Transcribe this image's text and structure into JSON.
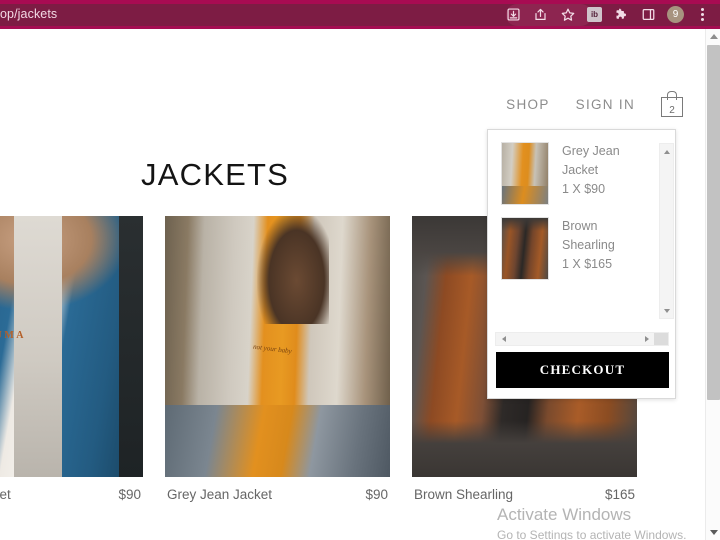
{
  "browser": {
    "url_text": "op/jackets",
    "toolbar_icons": [
      {
        "name": "install-app-icon",
        "glyph": "⤓"
      },
      {
        "name": "share-icon",
        "glyph": "⤴"
      },
      {
        "name": "bookmark-star-icon",
        "glyph": "☆"
      },
      {
        "name": "extension-badge-icon",
        "glyph": "ib"
      },
      {
        "name": "puzzle-extensions-icon",
        "glyph": "❖"
      },
      {
        "name": "side-panel-icon",
        "glyph": "▧"
      },
      {
        "name": "profile-avatar",
        "glyph": "9"
      },
      {
        "name": "browser-menu-icon",
        "glyph": "⋮"
      }
    ],
    "profile_initial": "9",
    "extension_badge_label": "ib"
  },
  "site": {
    "nav": [
      {
        "label": "SHOP",
        "name": "nav-link-shop"
      },
      {
        "label": "SIGN IN",
        "name": "nav-link-sign-in"
      }
    ],
    "cart_badge_count": "2",
    "page_title": "JACKETS"
  },
  "products": [
    {
      "name": "Blue Jean Jacket",
      "display_name": "ue Jean Jacket",
      "price": "$90",
      "photo_class": "ph-blue",
      "shirt_text": "PUMA"
    },
    {
      "name": "Grey Jean Jacket",
      "display_name": "Grey Jean Jacket",
      "price": "$90",
      "photo_class": "ph-grey",
      "shirt_text": "not your baby"
    },
    {
      "name": "Brown Shearling",
      "display_name": "Brown Shearling",
      "price": "$165",
      "photo_class": "ph-brown",
      "shirt_text": ""
    }
  ],
  "cart": {
    "items": [
      {
        "title": "Grey Jean",
        "title2": "Jacket",
        "qty_price": "1 X $90",
        "thumb_class": "t-grey"
      },
      {
        "title": "Brown",
        "title2": "Shearling",
        "qty_price": "1 X $165",
        "thumb_class": "t-brown"
      }
    ],
    "checkout_label": "CHECKOUT"
  },
  "watermark": {
    "title": "Activate Windows",
    "subtitle": "Go to Settings to activate Windows."
  },
  "colors": {
    "titlebar": "#7d1c44",
    "titlebar_accent": "#a80b52",
    "checkout_bg": "#000000",
    "text_muted": "#8a8a8a"
  }
}
